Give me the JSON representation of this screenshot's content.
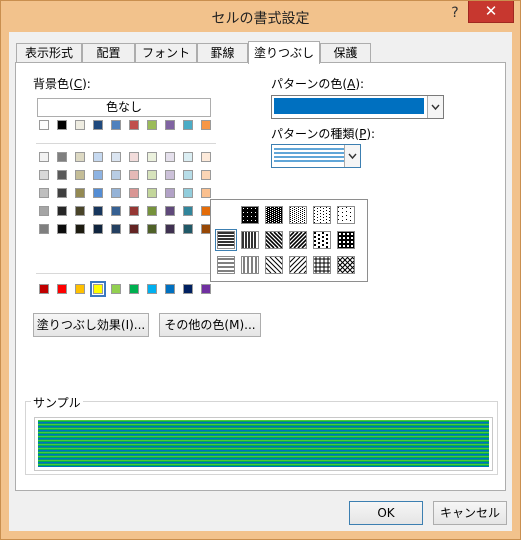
{
  "window": {
    "title": "セルの書式設定",
    "help": "?",
    "close": "✕"
  },
  "tabs": [
    {
      "label": "表示形式"
    },
    {
      "label": "配置"
    },
    {
      "label": "フォント"
    },
    {
      "label": "罫線"
    },
    {
      "label": "塗りつぶし"
    },
    {
      "label": "保護"
    }
  ],
  "background": {
    "label_pre": "背景色(",
    "label_key": "C",
    "label_post": "):",
    "no_color": "色なし",
    "theme_row": [
      "#ffffff",
      "#000000",
      "#eeece1",
      "#1f497d",
      "#4f81bd",
      "#c0504d",
      "#9bbb59",
      "#8064a2",
      "#4bacc6",
      "#f79646"
    ],
    "shades": [
      [
        "#f2f2f2",
        "#7f7f7f",
        "#ddd9c3",
        "#c6d9f0",
        "#dbe5f1",
        "#f2dcdb",
        "#ebf1dd",
        "#e5e0ec",
        "#dbeef3",
        "#fdeada"
      ],
      [
        "#d8d8d8",
        "#595959",
        "#c4bd97",
        "#8db3e2",
        "#b8cce4",
        "#e5b9b7",
        "#d7e3bc",
        "#ccc1d9",
        "#b7dde8",
        "#fbd5b5"
      ],
      [
        "#bfbfbf",
        "#3f3f3f",
        "#938953",
        "#548dd4",
        "#95b3d7",
        "#d99694",
        "#c3d69b",
        "#b2a2c7",
        "#92cddc",
        "#fac08f"
      ],
      [
        "#a5a5a5",
        "#262626",
        "#494429",
        "#17365d",
        "#366092",
        "#953734",
        "#76923c",
        "#5f497a",
        "#31859b",
        "#e36c09"
      ],
      [
        "#7f7f7f",
        "#0c0c0c",
        "#1d1b10",
        "#0f243e",
        "#244061",
        "#632423",
        "#4f6128",
        "#3f3151",
        "#205867",
        "#974806"
      ]
    ],
    "standard": [
      "#c00000",
      "#ff0000",
      "#ffc000",
      "#ffff00",
      "#92d050",
      "#00b050",
      "#00b0f0",
      "#0070c0",
      "#002060",
      "#7030a0"
    ],
    "selected_standard_index": 3
  },
  "fill_effects_button": "塗りつぶし効果(I)...",
  "more_colors_button": "その他の色(M)...",
  "pattern_color": {
    "label_pre": "パターンの色(",
    "label_key": "A",
    "label_post": "):",
    "value": "#0070c0"
  },
  "pattern_style": {
    "label_pre": "パターンの種類(",
    "label_key": "P",
    "label_post": "):",
    "selected_row": 1,
    "selected_col": 0,
    "patterns": [
      [
        "dense-fill",
        "checker-75",
        "dot-50",
        "dot-25",
        "dot-12"
      ],
      [
        "h-stripe",
        "v-stripe",
        "diag-rev",
        "diag",
        "checker-bold",
        "diag-cross-bold"
      ],
      [
        "h-thin",
        "v-thin",
        "diag-rev-thin",
        "diag-thin",
        "grid-thin",
        "diag-cross-thin"
      ]
    ]
  },
  "sample": {
    "label": "サンプル",
    "bg": "#ffff00",
    "fg": "#0070c0",
    "accent": "#00b050"
  },
  "buttons": {
    "ok": "OK",
    "cancel": "キャンセル"
  }
}
